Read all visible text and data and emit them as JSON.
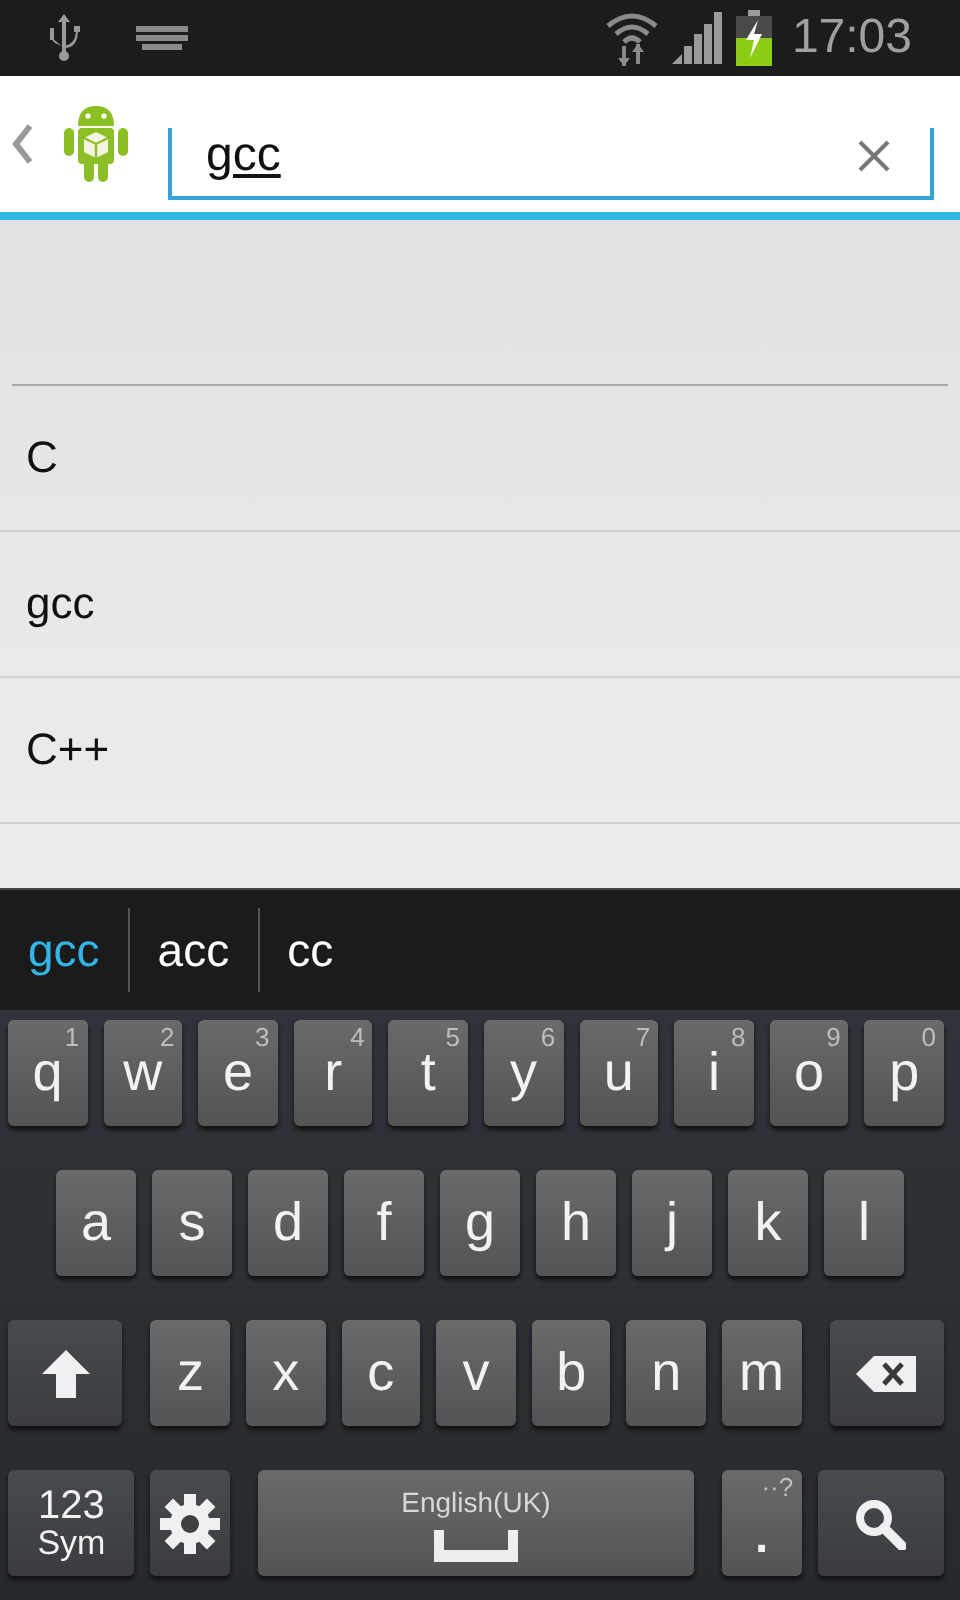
{
  "status_bar": {
    "time": "17:03"
  },
  "search": {
    "value": "gcc",
    "composing": true
  },
  "suggestions": [
    {
      "label": "C"
    },
    {
      "label": "gcc"
    },
    {
      "label": "C++"
    }
  ],
  "candidates": [
    {
      "label": "gcc",
      "selected": true
    },
    {
      "label": "acc",
      "selected": false
    },
    {
      "label": "cc",
      "selected": false
    }
  ],
  "keyboard": {
    "rows": [
      {
        "keys": [
          {
            "kind": "char",
            "label": "q",
            "hint": "1"
          },
          {
            "kind": "char",
            "label": "w",
            "hint": "2"
          },
          {
            "kind": "char",
            "label": "e",
            "hint": "3"
          },
          {
            "kind": "char",
            "label": "r",
            "hint": "4"
          },
          {
            "kind": "char",
            "label": "t",
            "hint": "5"
          },
          {
            "kind": "char",
            "label": "y",
            "hint": "6"
          },
          {
            "kind": "char",
            "label": "u",
            "hint": "7"
          },
          {
            "kind": "char",
            "label": "i",
            "hint": "8"
          },
          {
            "kind": "char",
            "label": "o",
            "hint": "9"
          },
          {
            "kind": "char",
            "label": "p",
            "hint": "0"
          }
        ]
      },
      {
        "keys": [
          {
            "kind": "char",
            "label": "a"
          },
          {
            "kind": "char",
            "label": "s"
          },
          {
            "kind": "char",
            "label": "d"
          },
          {
            "kind": "char",
            "label": "f"
          },
          {
            "kind": "char",
            "label": "g"
          },
          {
            "kind": "char",
            "label": "h"
          },
          {
            "kind": "char",
            "label": "j"
          },
          {
            "kind": "char",
            "label": "k"
          },
          {
            "kind": "char",
            "label": "l"
          }
        ]
      },
      {
        "keys": [
          {
            "kind": "shift"
          },
          {
            "kind": "char",
            "label": "z"
          },
          {
            "kind": "char",
            "label": "x"
          },
          {
            "kind": "char",
            "label": "c"
          },
          {
            "kind": "char",
            "label": "v"
          },
          {
            "kind": "char",
            "label": "b"
          },
          {
            "kind": "char",
            "label": "n"
          },
          {
            "kind": "char",
            "label": "m"
          },
          {
            "kind": "backspace"
          }
        ]
      },
      {
        "keys": [
          {
            "kind": "symbols",
            "label": "123",
            "sublabel": "Sym"
          },
          {
            "kind": "settings"
          },
          {
            "kind": "space",
            "label": "English(UK)"
          },
          {
            "kind": "period",
            "label": ".",
            "hint": "··?"
          },
          {
            "kind": "search"
          }
        ]
      }
    ]
  }
}
